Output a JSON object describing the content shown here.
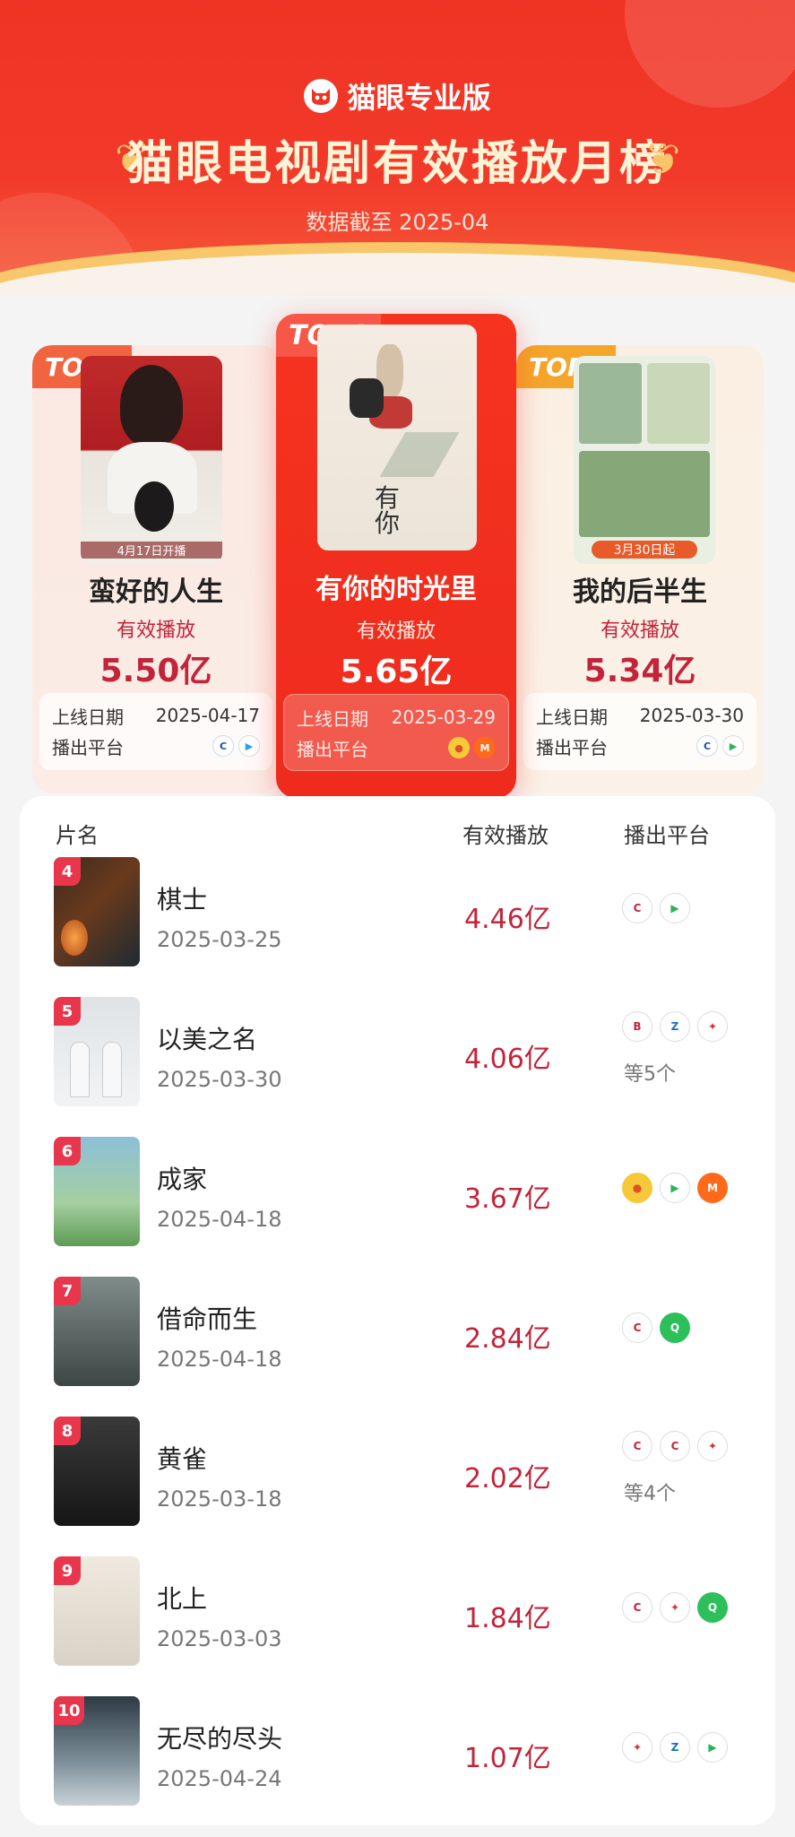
{
  "header": {
    "brand": "猫眼专业版",
    "title": "猫眼电视剧有效播放月榜",
    "subtitle": "数据截至 2025-04"
  },
  "top3": [
    {
      "rank": "TOP1",
      "name": "有你的时光里",
      "plays_label": "有效播放",
      "plays": "5.65亿",
      "date_label": "上线日期",
      "date": "2025-03-29",
      "platform_label": "播出平台"
    },
    {
      "rank": "TOP2",
      "name": "蛮好的人生",
      "plays_label": "有效播放",
      "plays": "5.50亿",
      "date_label": "上线日期",
      "date": "2025-04-17",
      "platform_label": "播出平台",
      "poster_caption": "4月17日开播"
    },
    {
      "rank": "TOP3",
      "name": "我的后半生",
      "plays_label": "有效播放",
      "plays": "5.34亿",
      "date_label": "上线日期",
      "date": "2025-03-30",
      "platform_label": "播出平台",
      "poster_caption": "3月30日起"
    }
  ],
  "list": {
    "headers": {
      "name": "片名",
      "plays": "有效播放",
      "platform": "播出平台"
    },
    "rows": [
      {
        "rank": "4",
        "name": "棋士",
        "date": "2025-03-25",
        "plays": "4.46亿",
        "more": ""
      },
      {
        "rank": "5",
        "name": "以美之名",
        "date": "2025-03-30",
        "plays": "4.06亿",
        "more": "等5个"
      },
      {
        "rank": "6",
        "name": "成家",
        "date": "2025-04-18",
        "plays": "3.67亿",
        "more": ""
      },
      {
        "rank": "7",
        "name": "借命而生",
        "date": "2025-04-18",
        "plays": "2.84亿",
        "more": ""
      },
      {
        "rank": "8",
        "name": "黄雀",
        "date": "2025-03-18",
        "plays": "2.02亿",
        "more": "等4个"
      },
      {
        "rank": "9",
        "name": "北上",
        "date": "2025-03-03",
        "plays": "1.84亿",
        "more": ""
      },
      {
        "rank": "10",
        "name": "无尽的尽头",
        "date": "2025-04-24",
        "plays": "1.07亿",
        "more": ""
      }
    ]
  },
  "colors": {
    "brand_red": "#ef3324",
    "value_red": "#c2243a",
    "gold": "#f7c76a"
  }
}
